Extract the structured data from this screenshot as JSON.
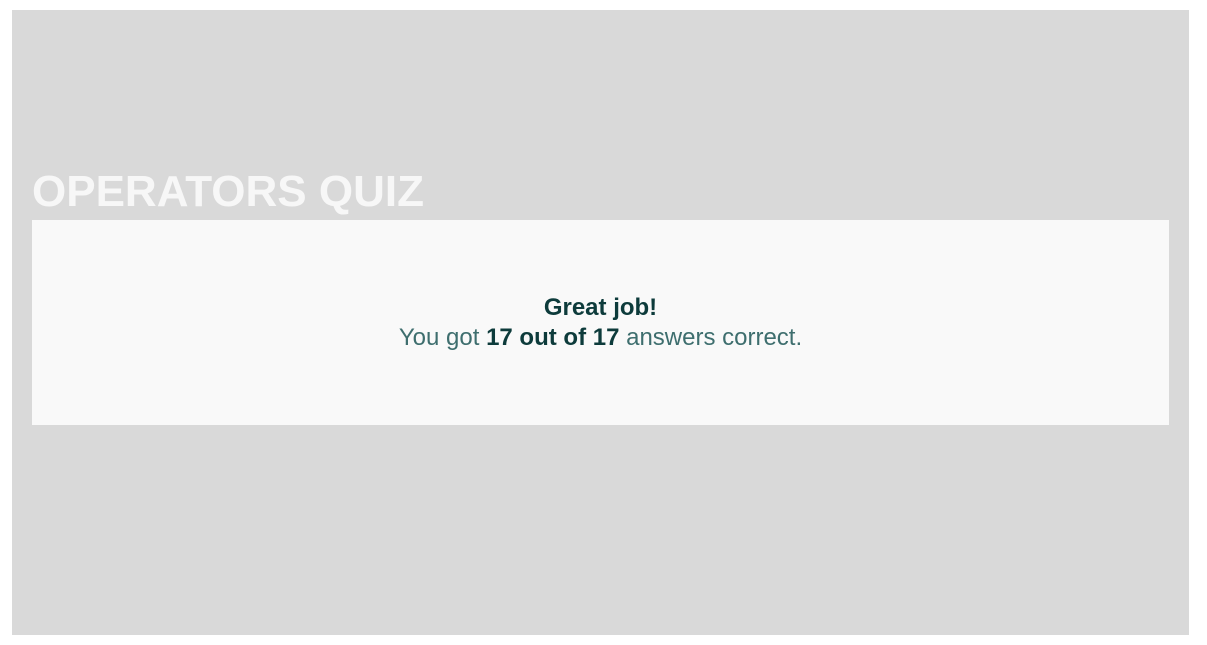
{
  "quiz": {
    "title": "OPERATORS QUIZ"
  },
  "result": {
    "headline": "Great job!",
    "prefix": "You got ",
    "score": "17 out of 17",
    "suffix": " answers correct."
  },
  "colors": {
    "background": "#d9d9d9",
    "card": "#f9f9f9",
    "title": "#f7f7f7",
    "accent_dark": "#0d3b3b",
    "text_muted": "#3e6e6e"
  }
}
